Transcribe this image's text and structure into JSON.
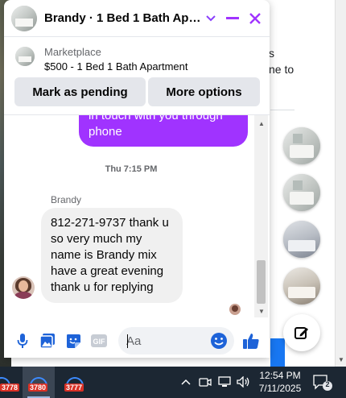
{
  "chat": {
    "title": "Brandy · 1 Bed 1 Bath Apartment",
    "listing": {
      "label": "Marketplace",
      "title": "$500 - 1 Bed 1 Bath Apartment"
    },
    "actions": {
      "pending": "Mark as pending",
      "more": "More options"
    },
    "messages": {
      "outgoing_partial": "in touch with you through phone",
      "timestamp": "Thu 7:15 PM",
      "sender": "Brandy",
      "incoming": "812-271-9737 thank u so very much  my name is Brandy mix have a great evening thank u for replying"
    },
    "composer": {
      "placeholder": "Aa"
    }
  },
  "background": {
    "text_line1": "s",
    "text_line2": "ne to"
  },
  "taskbar": {
    "apps": [
      {
        "badge": "3778"
      },
      {
        "badge": "3780"
      },
      {
        "badge": "3777"
      }
    ],
    "time": "12:54 PM",
    "date": "7/11/2025",
    "notification_count": "2"
  },
  "colors": {
    "accent": "#a033ff",
    "facebook_blue": "#1877f2",
    "taskbar": "#1c2733"
  }
}
